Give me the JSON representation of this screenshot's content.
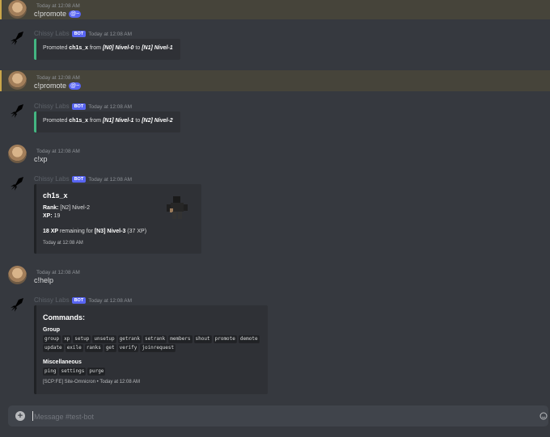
{
  "messages": [
    {
      "user_name": "",
      "timestamp": "Today at 12:08 AM",
      "text": "c!promote",
      "mention": "@~"
    },
    {
      "bot_name": "Chissy Labs",
      "bot_tag": "BOT",
      "timestamp": "Today at 12:08 AM",
      "embed": {
        "prefix": "Promoted ",
        "user": "ch1s_x",
        "from_word": " from ",
        "from_rank": "[N0] Nivel-0",
        "to_word": " to ",
        "to_rank": "[N1] Nivel-1"
      }
    },
    {
      "user_name": "",
      "timestamp": "Today at 12:08 AM",
      "text": "c!promote",
      "mention": "@~"
    },
    {
      "bot_name": "Chissy Labs",
      "bot_tag": "BOT",
      "timestamp": "Today at 12:08 AM",
      "embed": {
        "prefix": "Promoted ",
        "user": "ch1s_x",
        "from_word": " from ",
        "from_rank": "[N1] Nivel-1",
        "to_word": " to ",
        "to_rank": "[N2] Nivel-2"
      }
    },
    {
      "user_name": "",
      "timestamp": "Today at 12:08 AM",
      "text": "c!xp"
    },
    {
      "bot_name": "Chissy Labs",
      "bot_tag": "BOT",
      "timestamp": "Today at 12:08 AM",
      "embed": {
        "title": "ch1s_x",
        "rank_label": "Rank:",
        "rank_value": " [N2] Nivel-2",
        "xp_label": "XP:",
        "xp_value": " 19",
        "remaining_xp": "18 XP",
        "remaining_text": " remaining for ",
        "next_rank": "[N3] Nivel-3",
        "next_xp": " (37 XP)",
        "footer": "Today at 12:08 AM"
      }
    },
    {
      "user_name": "",
      "timestamp": "Today at 12:08 AM",
      "text": "c!help"
    },
    {
      "bot_name": "Chissy Labs",
      "bot_tag": "BOT",
      "timestamp": "Today at 12:08 AM",
      "embed": {
        "title": "Commands:",
        "group_title": "Group",
        "group_cmds_1": [
          "group",
          "xp",
          "setup",
          "unsetup",
          "getrank",
          "setrank",
          "members",
          "shout",
          "promote",
          "demote"
        ],
        "group_cmds_2": [
          "update",
          "exile",
          "ranks",
          "get",
          "verify",
          "joinrequest"
        ],
        "misc_title": "Miscellaneous",
        "misc_cmds": [
          "ping",
          "settings",
          "purge"
        ],
        "footer": "[SCP:FE] Site-Omnicron • Today at 12:08 AM"
      }
    }
  ],
  "input": {
    "placeholder": "Message #test-bot",
    "add_icon": "plus-circle-icon",
    "emoji_icon": "emoji-icon"
  },
  "colors": {
    "background": "#36393f",
    "embed_bg": "#2f3136",
    "embed_accent": "#43b581",
    "bot_tag": "#5865f2",
    "highlight": "#46443a"
  }
}
